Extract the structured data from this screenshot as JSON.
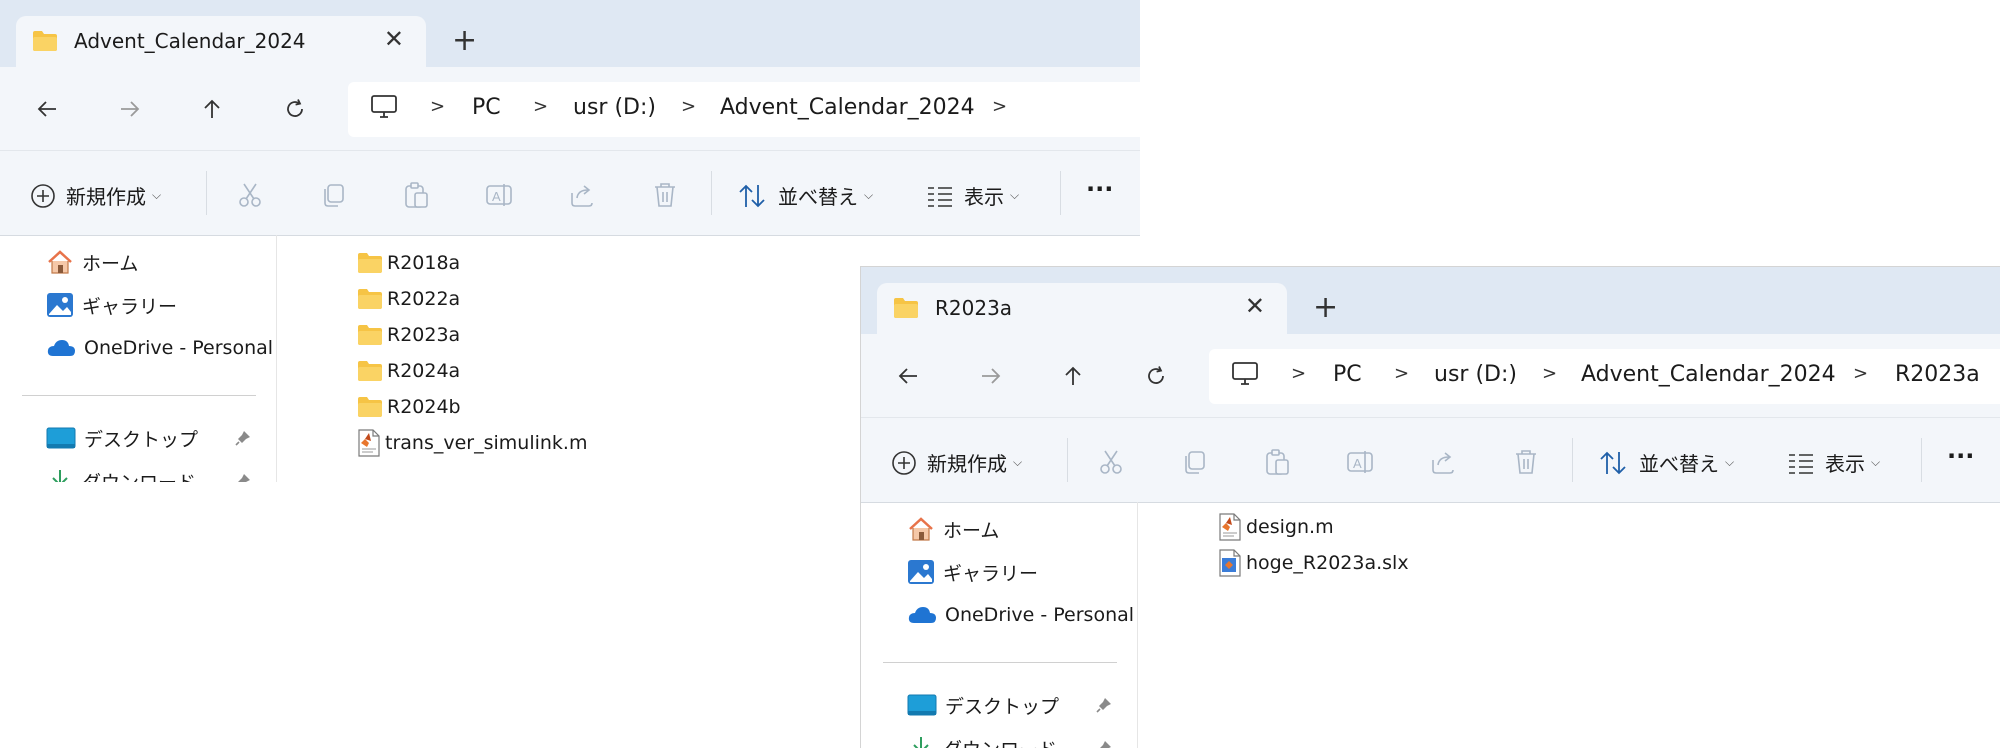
{
  "window1": {
    "tab_title": "Advent_Calendar_2024",
    "breadcrumb": [
      "PC",
      "usr (D:)",
      "Advent_Calendar_2024"
    ],
    "toolbar": {
      "new_label": "新規作成",
      "sort_label": "並べ替え",
      "view_label": "表示"
    },
    "sidebar": {
      "home": "ホーム",
      "gallery": "ギャラリー",
      "onedrive": "OneDrive - Personal",
      "desktop": "デスクトップ",
      "downloads": "ダウンロード"
    },
    "files": [
      {
        "name": "R2018a",
        "type": "folder"
      },
      {
        "name": "R2022a",
        "type": "folder"
      },
      {
        "name": "R2023a",
        "type": "folder"
      },
      {
        "name": "R2024a",
        "type": "folder"
      },
      {
        "name": "R2024b",
        "type": "folder"
      },
      {
        "name": "trans_ver_simulink.m",
        "type": "matlab-script"
      }
    ]
  },
  "window2": {
    "tab_title": "R2023a",
    "breadcrumb": [
      "PC",
      "usr (D:)",
      "Advent_Calendar_2024",
      "R2023a"
    ],
    "toolbar": {
      "new_label": "新規作成",
      "sort_label": "並べ替え",
      "view_label": "表示"
    },
    "sidebar": {
      "home": "ホーム",
      "gallery": "ギャラリー",
      "onedrive": "OneDrive - Personal",
      "desktop": "デスクトップ",
      "downloads": "ダウンロード"
    },
    "files": [
      {
        "name": "design.m",
        "type": "matlab-script"
      },
      {
        "name": "hoge_R2023a.slx",
        "type": "simulink-model"
      }
    ]
  },
  "colors": {
    "tabbar": "#dfe8f3",
    "chrome": "#f3f6fa",
    "folder": "#f6c445",
    "onedrive": "#1f74d3",
    "home": "#e8734a"
  },
  "icons": [
    "folder-icon",
    "close-icon",
    "plus-icon",
    "back-arrow-icon",
    "forward-arrow-icon",
    "up-arrow-icon",
    "refresh-icon",
    "computer-icon",
    "chevron-right-icon",
    "new-circle-plus-icon",
    "cut-icon",
    "copy-icon",
    "paste-icon",
    "rename-icon",
    "share-icon",
    "delete-icon",
    "sort-icon",
    "view-icon",
    "more-icon",
    "home-icon",
    "gallery-icon",
    "onedrive-icon",
    "desktop-icon",
    "download-icon",
    "pin-icon",
    "matlab-file-icon",
    "simulink-file-icon"
  ]
}
